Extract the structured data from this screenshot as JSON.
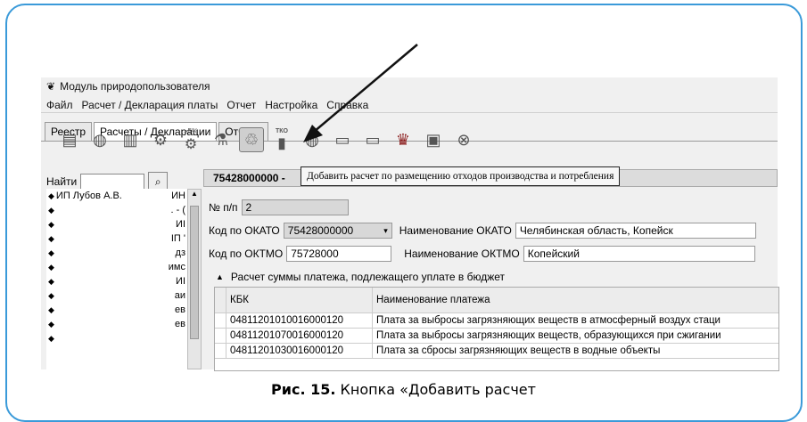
{
  "window": {
    "title": "Модуль природопользователя"
  },
  "menu": [
    "Файл",
    "Расчет / Декларация платы",
    "Отчет",
    "Настройка",
    "Справка"
  ],
  "tabs": [
    "Реестр",
    "Расчеты / Декларации",
    "Отчеты"
  ],
  "toolbar": {
    "buttons": [
      "add-doc-icon",
      "globe-add-icon",
      "document-stack-icon",
      "add-calc-1-icon",
      "add-calc-over-icon",
      "add-calc-pipe-icon",
      "waste-add-icon",
      "tko-icon",
      "globe-remove-icon",
      "doc-export-icon",
      "doc-delete-icon",
      "emblem-icon",
      "save-icon",
      "close-icon"
    ],
    "tko_label": "ТКО",
    "over_label": ">5%"
  },
  "left": {
    "find_label": "Найти",
    "items": [
      {
        "name": "ИП Лубов А.В.",
        "tail": "ИН"
      },
      {
        "name": "",
        "tail": ". - ("
      },
      {
        "name": "",
        "tail": "ИI"
      },
      {
        "name": "",
        "tail": "ІП '"
      },
      {
        "name": "",
        "tail": "дз"
      },
      {
        "name": "",
        "tail": "имс"
      },
      {
        "name": "",
        "tail": "ИI"
      },
      {
        "name": "",
        "tail": "аи"
      },
      {
        "name": "",
        "tail": "ев"
      },
      {
        "name": "",
        "tail": "ев"
      },
      {
        "name": "",
        "tail": ""
      }
    ]
  },
  "right": {
    "header_prefix": "75428000000 -",
    "np_label": "№ п/п",
    "np_value": "2",
    "okato_label": "Код по ОКАТО",
    "okato_value": "75428000000",
    "okato_name_label": "Наименование ОКАТО",
    "okato_name_value": "Челябинская область, Копейск",
    "oktmo_label": "Код по ОКТМО",
    "oktmo_value": "75728000",
    "oktmo_name_label": "Наименование ОКТМО",
    "oktmo_name_value": "Копейский",
    "section_title": "Расчет суммы платежа, подлежащего уплате в бюджет",
    "grid": {
      "headers": [
        "КБК",
        "Наименование платежа"
      ],
      "rows": [
        [
          "04811201010016000120",
          "Плата за выбросы загрязняющих веществ в атмосферный воздух стаци"
        ],
        [
          "04811201070016000120",
          "Плата за выбросы загрязняющих веществ, образующихся при сжигании"
        ],
        [
          "04811201030016000120",
          "Плата за сбросы загрязняющих веществ в водные объекты"
        ]
      ]
    }
  },
  "tooltip": "Добавить расчет по размещению отходов производства и потребления",
  "caption": {
    "bold": "Рис. 15.",
    "text": " Кнопка «Добавить расчет"
  }
}
